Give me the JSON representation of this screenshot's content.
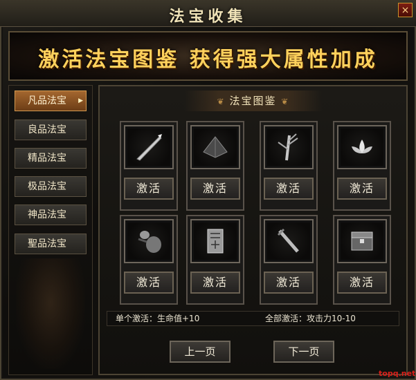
{
  "window": {
    "title": "法宝收集",
    "close_glyph": "×"
  },
  "banner": {
    "text": "激活法宝图鉴 获得强大属性加成"
  },
  "sidebar": {
    "items": [
      {
        "label": "凡品法宝",
        "active": true
      },
      {
        "label": "良品法宝",
        "active": false
      },
      {
        "label": "精品法宝",
        "active": false
      },
      {
        "label": "极品法宝",
        "active": false
      },
      {
        "label": "神品法宝",
        "active": false
      },
      {
        "label": "聖品法宝",
        "active": false
      }
    ]
  },
  "panel": {
    "title": "法宝图鉴",
    "items": [
      {
        "icon": "spear-icon",
        "button": "激活"
      },
      {
        "icon": "pyramid-icon",
        "button": "激活"
      },
      {
        "icon": "bamboo-icon",
        "button": "激活"
      },
      {
        "icon": "lotus-icon",
        "button": "激活"
      },
      {
        "icon": "gourd-icon",
        "button": "激活"
      },
      {
        "icon": "talisman-icon",
        "button": "激活"
      },
      {
        "icon": "sword-icon",
        "button": "激活"
      },
      {
        "icon": "chest-icon",
        "button": "激活"
      }
    ],
    "single_bonus": "单个激活：生命值+10",
    "full_bonus": "全部激活：攻击力10-10"
  },
  "pager": {
    "prev": "上一页",
    "next": "下一页"
  },
  "watermark": "topq.net"
}
